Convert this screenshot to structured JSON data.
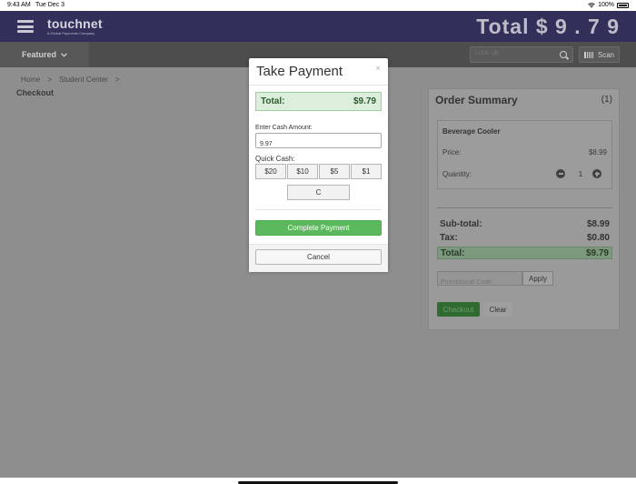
{
  "status_bar": {
    "time": "9:43 AM",
    "date": "Tue Dec 3",
    "battery": "100%"
  },
  "header": {
    "logo_name": "touchnet",
    "logo_sub": "A Global Payments Company",
    "total_display": "Total $ 9 . 7 9"
  },
  "navbar": {
    "featured_label": "Featured",
    "lookup_placeholder": "Look Up",
    "scan_label": "Scan"
  },
  "breadcrumb": {
    "home": "Home",
    "sep": ">",
    "student_center": "Student Center"
  },
  "page_title": "Checkout",
  "order_summary": {
    "title": "Order Summary",
    "count": "(1)",
    "item": {
      "name": "Beverage Cooler",
      "price_label": "Price:",
      "price": "$8.99",
      "quantity_label": "Quantity:",
      "quantity": "1"
    },
    "subtotal_label": "Sub-total:",
    "subtotal": "$8.99",
    "tax_label": "Tax:",
    "tax": "$0.80",
    "total_label": "Total:",
    "total": "$9.79",
    "promo_placeholder": "Promotional Code",
    "apply_label": "Apply",
    "checkout_label": "Checkout",
    "clear_label": "Clear"
  },
  "modal": {
    "title": "Take Payment",
    "close": "×",
    "total_label": "Total:",
    "total_value": "$9.79",
    "cash_label": "Enter Cash Amount:",
    "cash_value": "9.97",
    "quick_label": "Quick Cash:",
    "quick_buttons": [
      "$20",
      "$10",
      "$5",
      "$1"
    ],
    "clear_button": "C",
    "complete_label": "Complete Payment",
    "cancel_label": "Cancel"
  },
  "colors": {
    "header_bg": "#32305a",
    "complete_green": "#5cb85c",
    "total_green_bg": "#dcefdc"
  }
}
